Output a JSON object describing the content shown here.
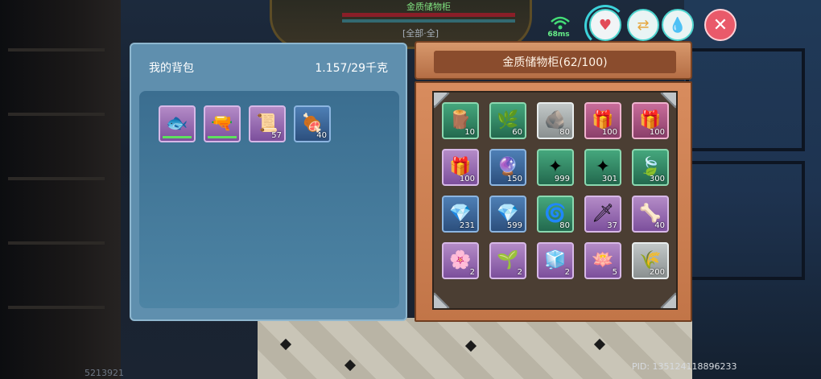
{
  "hud": {
    "top_title": "金质储物柜",
    "sub_label": "[全部·全]",
    "ping": "68ms",
    "close_glyph": "✕",
    "heart_glyph": "♥",
    "swap_glyph": "⇄",
    "water_glyph": "💧"
  },
  "backpack": {
    "title": "我的背包",
    "weight": "1.157/29千克",
    "items": [
      {
        "icon": "purple-fish-icon",
        "glyph": "🐟",
        "quality": "purple",
        "count": "",
        "bar": true
      },
      {
        "icon": "rifle-icon",
        "glyph": "🔫",
        "quality": "purple",
        "count": "",
        "bar": true
      },
      {
        "icon": "trophy-scroll-icon",
        "glyph": "📜",
        "quality": "purple",
        "count": "57",
        "bar": false
      },
      {
        "icon": "cooked-meat-icon",
        "glyph": "🍖",
        "quality": "blue",
        "count": "40",
        "bar": false
      }
    ]
  },
  "storage": {
    "title": "金质储物柜(62/100)",
    "items": [
      {
        "icon": "stump-icon",
        "glyph": "🪵",
        "quality": "green",
        "count": "10"
      },
      {
        "icon": "vine-icon",
        "glyph": "🌿",
        "quality": "green",
        "count": "60"
      },
      {
        "icon": "ore-icon",
        "glyph": "🪨",
        "quality": "white",
        "count": "80"
      },
      {
        "icon": "red-gift-icon",
        "glyph": "🎁",
        "quality": "red",
        "count": "100"
      },
      {
        "icon": "red-gift-icon",
        "glyph": "🎁",
        "quality": "red",
        "count": "100"
      },
      {
        "icon": "red-gift-icon",
        "glyph": "🎁",
        "quality": "purple",
        "count": "100"
      },
      {
        "icon": "pink-orb-icon",
        "glyph": "🔮",
        "quality": "blue",
        "count": "150"
      },
      {
        "icon": "green-star-icon",
        "glyph": "✦",
        "quality": "green",
        "count": "999"
      },
      {
        "icon": "green-star-icon",
        "glyph": "✦",
        "quality": "green",
        "count": "301"
      },
      {
        "icon": "leaf-icon",
        "glyph": "🍃",
        "quality": "green",
        "count": "300"
      },
      {
        "icon": "purple-crystal-icon",
        "glyph": "💎",
        "quality": "blue",
        "count": "231"
      },
      {
        "icon": "purple-crystal-icon",
        "glyph": "💎",
        "quality": "blue",
        "count": "599"
      },
      {
        "icon": "blue-orb-icon",
        "glyph": "🌀",
        "quality": "green",
        "count": "80"
      },
      {
        "icon": "blade-icon",
        "glyph": "🗡",
        "quality": "purple",
        "count": "37"
      },
      {
        "icon": "gold-horn-icon",
        "glyph": "🦴",
        "quality": "purple",
        "count": "40"
      },
      {
        "icon": "blue-flower-icon",
        "glyph": "🌸",
        "quality": "purple",
        "count": "2"
      },
      {
        "icon": "bulb-plant-icon",
        "glyph": "🌱",
        "quality": "purple",
        "count": "2"
      },
      {
        "icon": "ice-block-icon",
        "glyph": "🧊",
        "quality": "purple",
        "count": "2"
      },
      {
        "icon": "lotus-icon",
        "glyph": "🪷",
        "quality": "purple",
        "count": "5"
      },
      {
        "icon": "sprout-icon",
        "glyph": "🌾",
        "quality": "white",
        "count": "200"
      }
    ]
  },
  "footer": {
    "left_code": "5213921",
    "pid": "PID: 135124118896233"
  }
}
